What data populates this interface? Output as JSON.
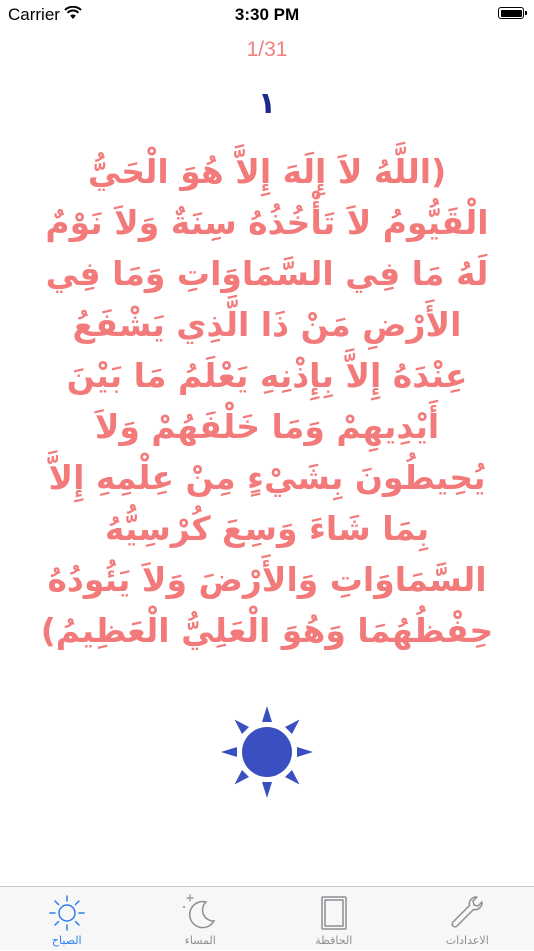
{
  "status_bar": {
    "carrier": "Carrier",
    "time": "3:30 PM"
  },
  "counter": "1/31",
  "repeat_count": "١",
  "dhikr_text": "(اللَّهُ لاَ إِلَهَ إِلاَّ هُوَ الْحَيُّ الْقَيُّومُ لاَ تَأْخُذُهُ سِنَةٌ وَلاَ نَوْمٌ لَهُ مَا فِي السَّمَاوَاتِ وَمَا فِي الأَرْضِ مَنْ ذَا الَّذِي يَشْفَعُ عِنْدَهُ إِلاَّ بِإِذْنِهِ يَعْلَمُ مَا بَيْنَ أَيْدِيهِمْ وَمَا خَلْفَهُمْ وَلاَ يُحِيطُونَ بِشَيْءٍ مِنْ عِلْمِهِ إِلاَّ بِمَا شَاءَ وَسِعَ كُرْسِيُّهُ السَّمَاوَاتِ وَالأَرْضَ وَلاَ يَئُودُهُ حِفْظُهُمَا وَهُوَ الْعَلِيُّ الْعَظِيمُ)",
  "colors": {
    "dhikr": "#f37a7a",
    "counter": "#f08080",
    "repeat": "#1c2a8c",
    "sun": "#3a4fc0",
    "tab_active": "#2a7ff0",
    "tab_inactive": "#8e8e93"
  },
  "tabs": [
    {
      "label": "الصباح",
      "icon": "sun-icon",
      "active": true
    },
    {
      "label": "المساء",
      "icon": "moon-icon",
      "active": false
    },
    {
      "label": "الحافظة",
      "icon": "book-icon",
      "active": false
    },
    {
      "label": "الاعدادات",
      "icon": "wrench-icon",
      "active": false
    }
  ]
}
